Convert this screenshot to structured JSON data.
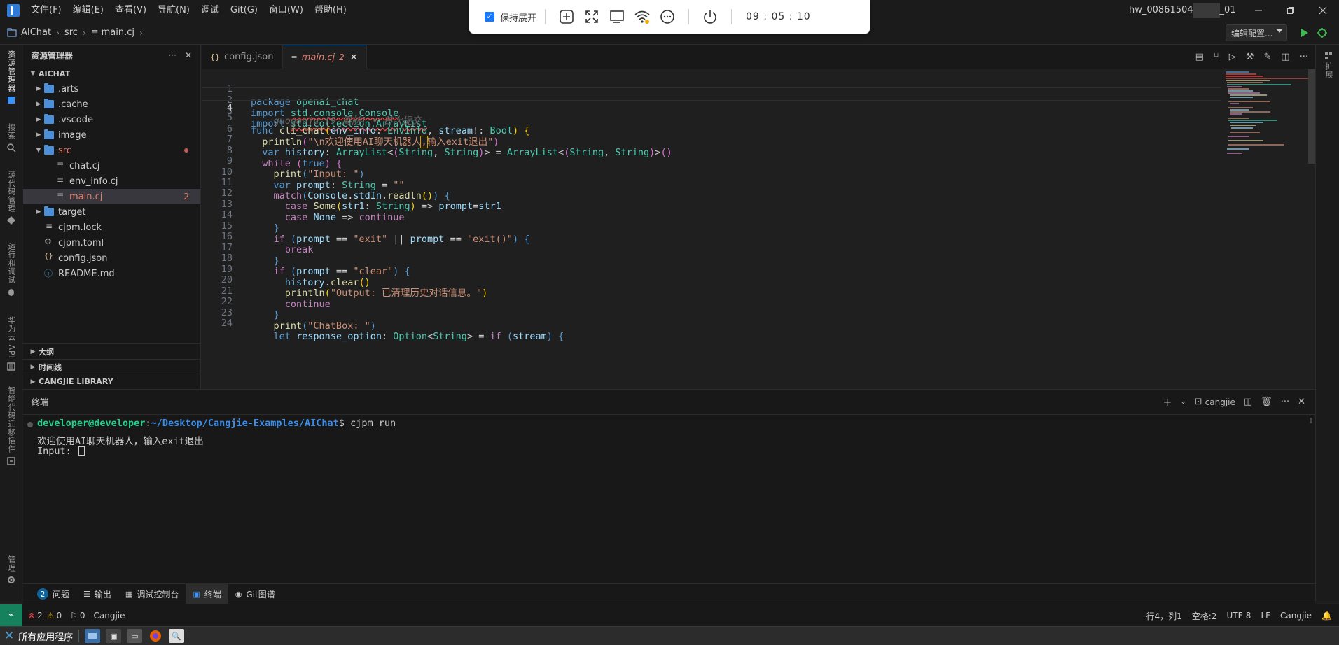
{
  "menu": [
    "文件(F)",
    "编辑(E)",
    "查看(V)",
    "导航(N)",
    "调试",
    "Git(G)",
    "窗口(W)",
    "帮助(H)"
  ],
  "remote_toolbar": {
    "keep_expand_label": "保持展开",
    "clock": "09 : 05 : 10"
  },
  "window_user": "hw_00861504",
  "window_user_suffix": "_01",
  "breadcrumb": [
    "AIChat",
    "src",
    "main.cj"
  ],
  "edit_config_label": "编辑配置...",
  "activity": [
    "资源管理器",
    "搜索",
    "源代码管理",
    "运行和调试",
    "华为云 API",
    "智能代码迁移插件",
    "管理"
  ],
  "right_strip_label": "扩展",
  "sidebar": {
    "title": "资源管理器",
    "root": "AICHAT",
    "tree": [
      {
        "name": ".arts",
        "kind": "folder",
        "depth": 0
      },
      {
        "name": ".cache",
        "kind": "folder",
        "depth": 0
      },
      {
        "name": ".vscode",
        "kind": "folder",
        "depth": 0
      },
      {
        "name": "image",
        "kind": "folder",
        "depth": 0
      },
      {
        "name": "src",
        "kind": "folder",
        "depth": 0
      },
      {
        "name": "chat.cj",
        "kind": "file",
        "depth": 1
      },
      {
        "name": "env_info.cj",
        "kind": "file",
        "depth": 1
      },
      {
        "name": "main.cj",
        "kind": "file",
        "depth": 1,
        "badge": "2"
      },
      {
        "name": "target",
        "kind": "folder",
        "depth": 0
      },
      {
        "name": "cjpm.lock",
        "kind": "lock",
        "depth": 0
      },
      {
        "name": "cjpm.toml",
        "kind": "gear",
        "depth": 0
      },
      {
        "name": "config.json",
        "kind": "json",
        "depth": 0
      },
      {
        "name": "README.md",
        "kind": "info",
        "depth": 0
      }
    ],
    "sections": [
      "大纲",
      "时间线",
      "CANGJIE LIBRARY"
    ]
  },
  "tabs": [
    {
      "name": "config.json",
      "icon": "{}",
      "active": false
    },
    {
      "name": "main.cj",
      "icon": "≡",
      "active": true,
      "count": "2"
    }
  ],
  "code_lines": [
    {
      "n": "1",
      "text": "package openai_chat"
    },
    {
      "n": "2",
      "text": "import std.console.Console"
    },
    {
      "n": "3",
      "text": "import std.collection.ArrayList"
    },
    {
      "n": "4",
      "text": "    guogaoju [9 周前] • 首次提交"
    },
    {
      "n": "5",
      "text": "func cli_chat(env_info: EnvInfo, stream!: Bool) {"
    },
    {
      "n": "6",
      "text": "  println(\"\\n欢迎使用AI聊天机器人,输入exit退出\")"
    },
    {
      "n": "7",
      "text": "  var history: ArrayList<(String, String)> = ArrayList<(String, String)>()"
    },
    {
      "n": "8",
      "text": "  while (true) {"
    },
    {
      "n": "9",
      "text": "    print(\"Input: \")"
    },
    {
      "n": "10",
      "text": "    var prompt: String = \"\""
    },
    {
      "n": "11",
      "text": "    match(Console.stdIn.readln()) {"
    },
    {
      "n": "12",
      "text": "      case Some(str1: String) => prompt=str1"
    },
    {
      "n": "13",
      "text": "      case None => continue"
    },
    {
      "n": "14",
      "text": "    }"
    },
    {
      "n": "15",
      "text": "    if (prompt == \"exit\" || prompt == \"exit()\") {"
    },
    {
      "n": "16",
      "text": "      break"
    },
    {
      "n": "17",
      "text": "    }"
    },
    {
      "n": "18",
      "text": "    if (prompt == \"clear\") {"
    },
    {
      "n": "19",
      "text": "      history.clear()"
    },
    {
      "n": "20",
      "text": "      println(\"Output: 已清理历史对话信息。\")"
    },
    {
      "n": "21",
      "text": "      continue"
    },
    {
      "n": "22",
      "text": "    }"
    },
    {
      "n": "23",
      "text": "    print(\"ChatBox: \")"
    },
    {
      "n": "24",
      "text": "    let response_option: Option<String> = if (stream) {"
    }
  ],
  "terminal": {
    "title": "终端",
    "shell_name": "cangjie",
    "prompt_user": "developer@developer",
    "prompt_path": "~/Desktop/Cangjie-Examples/AIChat",
    "command": "cjpm run",
    "output": [
      "欢迎使用AI聊天机器人，输入exit退出",
      "Input: "
    ]
  },
  "panel_tabs": [
    {
      "label": "问题",
      "badge": "2"
    },
    {
      "label": "输出"
    },
    {
      "label": "调试控制台"
    },
    {
      "label": "终端",
      "active": true
    },
    {
      "label": "Git图谱"
    }
  ],
  "status": {
    "errors": "2",
    "warnings": "0",
    "ports": "0",
    "language_left": "Cangjie",
    "position": "行4，列1",
    "spaces": "空格:2",
    "encoding": "UTF-8",
    "eol": "LF",
    "language": "Cangjie"
  },
  "taskbar": {
    "start_label": "所有应用程序"
  }
}
